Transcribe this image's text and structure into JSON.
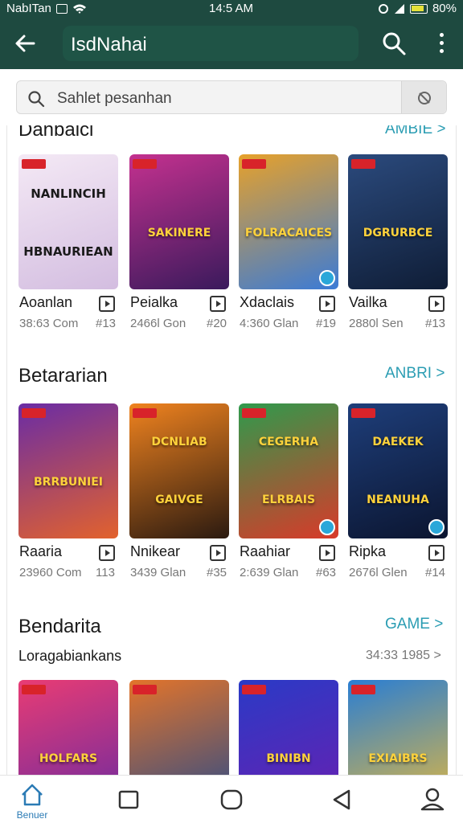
{
  "status_bar": {
    "carrier": "NabITan",
    "time": "14:5 AM",
    "battery": "80%"
  },
  "app_bar": {
    "title": "IsdNahai"
  },
  "search": {
    "placeholder": "Sahlet pesanhan"
  },
  "sections": [
    {
      "title": "Danbaici",
      "more": "AMBIE >",
      "games": [
        {
          "name": "Aoanlan",
          "size": "38:63 Com",
          "rank": "#13",
          "art": [
            "NANLINCIH",
            "HBNAURIEAN"
          ],
          "colors": [
            "#f4e9f5",
            "#d3bde0"
          ]
        },
        {
          "name": "Peialka",
          "size": "2466l Gon",
          "rank": "#20",
          "art": [
            "SAKINERE"
          ],
          "colors": [
            "#c4318f",
            "#3a1a5c"
          ]
        },
        {
          "name": "Xdaclais",
          "size": "4:360 Glan",
          "rank": "#19",
          "art": [
            "FOLRACAICES"
          ],
          "colors": [
            "#e7a12a",
            "#3b7bd6"
          ]
        },
        {
          "name": "Vailka",
          "size": "2880l Sen",
          "rank": "#13",
          "art": [
            "DGRURBCE"
          ],
          "colors": [
            "#2b4a7d",
            "#0f1d36"
          ]
        }
      ]
    },
    {
      "title": "Betararian",
      "more": "ANBRI >",
      "games": [
        {
          "name": "Raaria",
          "size": "23960 Com",
          "rank": "113",
          "art": [
            "BRRBUNIEI"
          ],
          "colors": [
            "#6a2ca5",
            "#e2622d"
          ]
        },
        {
          "name": "Nnikear",
          "size": "3439 Glan",
          "rank": "#35",
          "art": [
            "DCNLIAB",
            "GAIVGE"
          ],
          "colors": [
            "#f0831f",
            "#2b1a10"
          ]
        },
        {
          "name": "Raahiar",
          "size": "2:639 Glan",
          "rank": "#63",
          "art": [
            "CEGERHA",
            "ELRBAIS"
          ],
          "colors": [
            "#2f9a4c",
            "#d83a2a"
          ]
        },
        {
          "name": "Ripka",
          "size": "2676l Glen",
          "rank": "#14",
          "art": [
            "DAEKEK",
            "NEANUHA"
          ],
          "colors": [
            "#1e3e7a",
            "#0b1530"
          ]
        }
      ]
    },
    {
      "title": "Bendarita",
      "more": "GAME >",
      "subtitle": "Loragabiankans",
      "meta": "34:33 1985 >",
      "games": [
        {
          "art": [
            "HOLFARS"
          ],
          "colors": [
            "#e93c74",
            "#6a2aa0"
          ]
        },
        {
          "art": [
            ""
          ],
          "colors": [
            "#e3742a",
            "#274a8a"
          ]
        },
        {
          "art": [
            "BINIBN"
          ],
          "colors": [
            "#2a3ac6",
            "#6a1fb0"
          ]
        },
        {
          "art": [
            "EXIAIBRS"
          ],
          "colors": [
            "#2a7ed3",
            "#e6b93c"
          ]
        }
      ]
    }
  ],
  "bottom_nav": {
    "home_label": "Benuer"
  },
  "colors": {
    "app_bar": "#1e4a40",
    "accent": "#2b9db3"
  }
}
